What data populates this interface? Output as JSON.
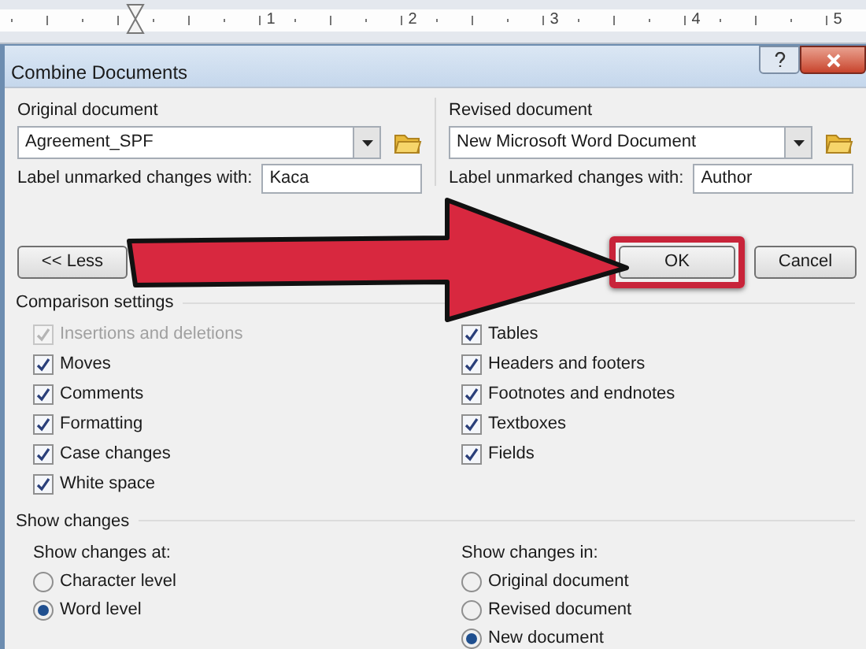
{
  "ruler": {
    "numbers": [
      "1",
      "2",
      "3",
      "4",
      "5"
    ]
  },
  "dialog": {
    "title": "Combine Documents",
    "original": {
      "label": "Original document",
      "value": "Agreement_SPF",
      "unmarked_label": "Label unmarked changes with:",
      "unmarked_value": "Kaca"
    },
    "revised": {
      "label": "Revised document",
      "value": "New Microsoft Word Document",
      "unmarked_label": "Label unmarked changes with:",
      "unmarked_value": "Author"
    },
    "buttons": [
      {
        "kind": "less",
        "label": "<< Less",
        "highlighted": false
      },
      {
        "kind": "ok",
        "label": "OK",
        "highlighted": true
      },
      {
        "kind": "cancel",
        "label": "Cancel",
        "highlighted": false
      }
    ],
    "comparison_settings": {
      "title": "Comparison settings",
      "left": [
        {
          "label": "Insertions and deletions",
          "checked": true,
          "disabled": true
        },
        {
          "label": "Moves",
          "checked": true,
          "disabled": false
        },
        {
          "label": "Comments",
          "checked": true,
          "disabled": false
        },
        {
          "label": "Formatting",
          "checked": true,
          "disabled": false
        },
        {
          "label": "Case changes",
          "checked": true,
          "disabled": false
        },
        {
          "label": "White space",
          "checked": true,
          "disabled": false
        }
      ],
      "right": [
        {
          "label": "Tables",
          "checked": true,
          "disabled": false
        },
        {
          "label": "Headers and footers",
          "checked": true,
          "disabled": false
        },
        {
          "label": "Footnotes and endnotes",
          "checked": true,
          "disabled": false
        },
        {
          "label": "Textboxes",
          "checked": true,
          "disabled": false
        },
        {
          "label": "Fields",
          "checked": true,
          "disabled": false
        }
      ]
    },
    "show_changes": {
      "title": "Show changes",
      "at": {
        "label": "Show changes at:",
        "options": [
          {
            "label": "Character level",
            "selected": false
          },
          {
            "label": "Word level",
            "selected": true
          }
        ]
      },
      "in": {
        "label": "Show changes in:",
        "options": [
          {
            "label": "Original document",
            "selected": false
          },
          {
            "label": "Revised document",
            "selected": false
          },
          {
            "label": "New document",
            "selected": true
          }
        ]
      }
    }
  }
}
